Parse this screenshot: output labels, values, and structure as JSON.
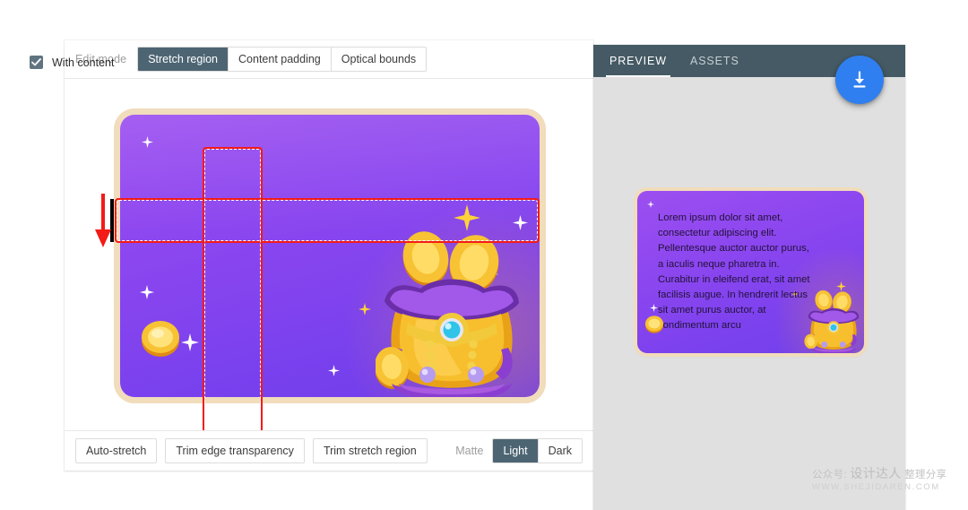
{
  "editor": {
    "edit_mode_label": "Edit mode",
    "modes": [
      {
        "label": "Stretch region",
        "active": true
      },
      {
        "label": "Content padding",
        "active": false
      },
      {
        "label": "Optical bounds",
        "active": false
      }
    ],
    "actions": [
      {
        "label": "Auto-stretch"
      },
      {
        "label": "Trim edge transparency"
      },
      {
        "label": "Trim stretch region"
      }
    ],
    "matte": {
      "label": "Matte",
      "options": [
        {
          "label": "Light",
          "active": true
        },
        {
          "label": "Dark",
          "active": false
        }
      ]
    },
    "markers": {
      "top_bar_name": "top-stretch-bar",
      "left_bar_name": "left-stretch-bar",
      "horizontal_region_name": "horizontal-stretch-region",
      "vertical_region_name": "vertical-stretch-region"
    }
  },
  "preview": {
    "tabs": [
      {
        "label": "PREVIEW",
        "active": true
      },
      {
        "label": "ASSETS",
        "active": false
      }
    ],
    "with_content": {
      "label": "With content",
      "checked": true
    },
    "bubble_text": "Lorem ipsum dolor sit amet, consectetur adipiscing elit. Pellentesque auctor auctor purus, a iaculis neque pharetra in. Curabitur in eleifend erat, sit amet facilisis augue. In hendrerit lectus sit amet purus auctor, at condimentum arcu",
    "download_button_icon": "download-icon"
  },
  "watermark": {
    "line1_prefix": "公众号: ",
    "line1_brand": "设计达人",
    "line1_suffix": " 整理分享",
    "line2": "WWW.SHEJIDAREN.COM"
  },
  "colors": {
    "accent_blue": "#2f7ff0",
    "tabbar_slate": "#455a64",
    "active_segment": "#4d6573",
    "marker_red": "#f31b17",
    "panel_gray": "#e0e0e0",
    "image_purple": "#8b46ef",
    "image_border_cream": "#f1dcbb",
    "treasure_gold": "#f5b324"
  }
}
